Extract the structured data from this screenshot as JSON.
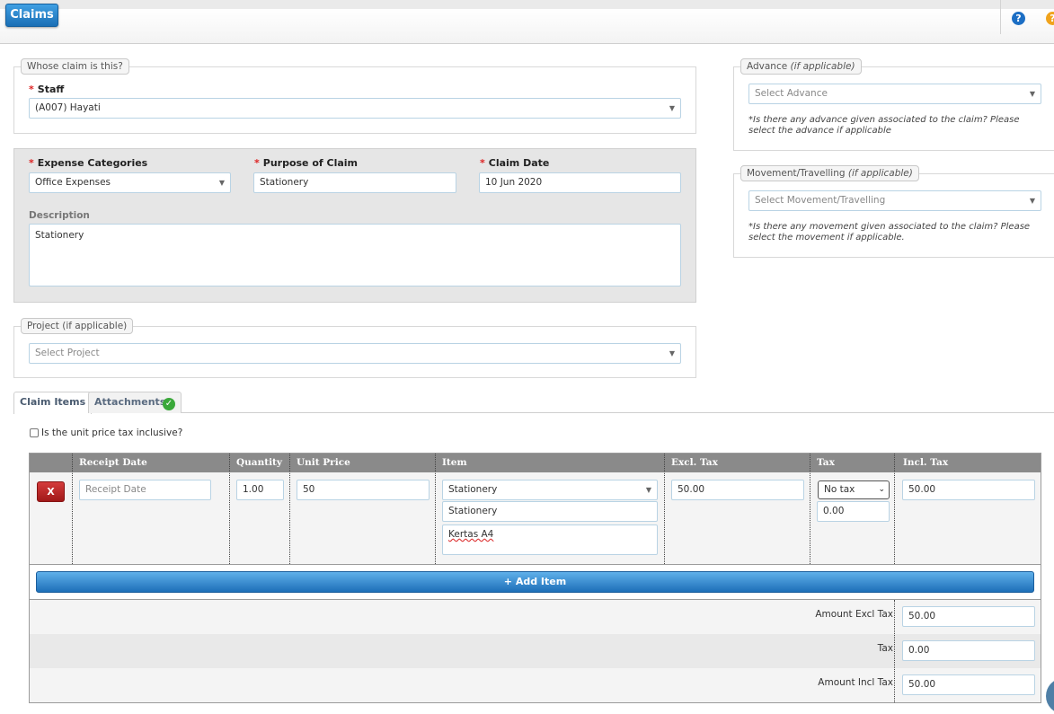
{
  "header": {
    "title": "Claims",
    "help_icon": "?",
    "other_icon": "?"
  },
  "whose_claim": {
    "legend": "Whose claim is this?",
    "staff_label": "Staff",
    "staff_value": "(A007) Hayati"
  },
  "expense": {
    "categories_label": "Expense Categories",
    "categories_value": "Office Expenses",
    "purpose_label": "Purpose of Claim",
    "purpose_value": "Stationery",
    "date_label": "Claim Date",
    "date_value": "10 Jun 2020",
    "description_label": "Description",
    "description_value": "Stationery"
  },
  "project": {
    "legend": "Project (if applicable)",
    "placeholder": "Select Project"
  },
  "advance": {
    "legend_main": "Advance",
    "legend_italic": "(if applicable)",
    "placeholder": "Select Advance",
    "note": "*Is there any advance given associated to the claim? Please select the advance if applicable"
  },
  "movement": {
    "legend_main": "Movement/Travelling",
    "legend_italic": "(if applicable)",
    "placeholder": "Select Movement/Travelling",
    "note": "*Is there any movement given associated to the claim? Please select the movement if applicable."
  },
  "tabs": [
    {
      "label": "Claim Items",
      "active": true
    },
    {
      "label": "Attachments",
      "active": false
    }
  ],
  "tax_inclusive_label": "Is the unit price tax inclusive?",
  "table": {
    "headers": {
      "receipt_date": "Receipt Date",
      "quantity": "Quantity",
      "unit_price": "Unit Price",
      "item": "Item",
      "excl_tax": "Excl. Tax",
      "tax": "Tax",
      "incl_tax": "Incl. Tax"
    },
    "row": {
      "delete_label": "X",
      "receipt_date_placeholder": "Receipt Date",
      "quantity": "1.00",
      "unit_price": "50",
      "item_select": "Stationery",
      "item_name": "Stationery",
      "item_desc": "Kertas A4",
      "excl_tax": "50.00",
      "tax_select": "No tax",
      "tax_amount": "0.00",
      "incl_tax": "50.00"
    },
    "add_item_label": "+ Add Item",
    "summary": {
      "amount_excl_label": "Amount Excl Tax",
      "amount_excl_value": "50.00",
      "tax_label": "Tax",
      "tax_value": "0.00",
      "amount_incl_label": "Amount Incl Tax",
      "amount_incl_value": "50.00"
    }
  }
}
